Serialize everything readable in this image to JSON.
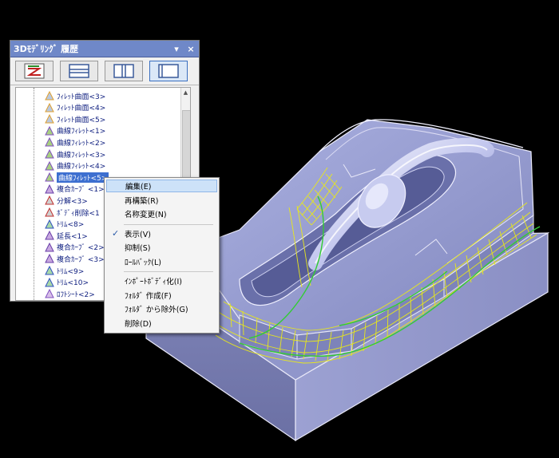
{
  "panel": {
    "title": "3Dﾓﾃﾞﾘﾝｸﾞ 履歴",
    "pin_glyph": "▾",
    "close_glyph": "×"
  },
  "toolbar": {
    "icons": [
      "history-regen-icon",
      "split-horizontal-icon",
      "split-vertical-icon",
      "single-pane-icon"
    ]
  },
  "tree": {
    "items": [
      {
        "label": "ﾌｨﾚｯﾄ曲面<3>",
        "icon": "fillet-surface-icon"
      },
      {
        "label": "ﾌｨﾚｯﾄ曲面<4>",
        "icon": "fillet-surface-icon"
      },
      {
        "label": "ﾌｨﾚｯﾄ曲面<5>",
        "icon": "fillet-surface-icon"
      },
      {
        "label": "曲線ﾌｨﾚｯﾄ<1>",
        "icon": "curve-fillet-icon"
      },
      {
        "label": "曲線ﾌｨﾚｯﾄ<2>",
        "icon": "curve-fillet-icon"
      },
      {
        "label": "曲線ﾌｨﾚｯﾄ<3>",
        "icon": "curve-fillet-icon"
      },
      {
        "label": "曲線ﾌｨﾚｯﾄ<4>",
        "icon": "curve-fillet-icon"
      },
      {
        "label": "曲線ﾌｨﾚｯﾄ<5>",
        "icon": "curve-fillet-icon",
        "selected": true
      },
      {
        "label": "複合ｶｰﾌﾞ <1>",
        "icon": "composite-curve-icon"
      },
      {
        "label": "分解<3>",
        "icon": "explode-icon"
      },
      {
        "label": "ﾎﾞﾃﾞｨ削除<1",
        "icon": "delete-body-icon"
      },
      {
        "label": "ﾄﾘﾑ<8>",
        "icon": "trim-icon"
      },
      {
        "label": "延長<1>",
        "icon": "extend-icon"
      },
      {
        "label": "複合ｶｰﾌﾞ <2>",
        "icon": "composite-curve-icon"
      },
      {
        "label": "複合ｶｰﾌﾞ <3>",
        "icon": "composite-curve-icon"
      },
      {
        "label": "ﾄﾘﾑ<9>",
        "icon": "trim-icon"
      },
      {
        "label": "ﾄﾘﾑ<10>",
        "icon": "trim-icon"
      },
      {
        "label": "ﾛﾌﾄｼｰﾄ<2>",
        "icon": "loft-sheet-icon"
      }
    ]
  },
  "context_menu": {
    "items": [
      {
        "label": "編集(E)",
        "highlighted": true
      },
      {
        "label": "再構築(R)"
      },
      {
        "label": "名称変更(N)"
      },
      {
        "separator": true
      },
      {
        "label": "表示(V)",
        "checked": true
      },
      {
        "label": "抑制(S)"
      },
      {
        "label": "ﾛｰﾙﾊﾞｯｸ(L)"
      },
      {
        "separator": true
      },
      {
        "label": "ｲﾝﾎﾟｰﾄﾎﾞﾃﾞｨ化(I)"
      },
      {
        "label": "ﾌｫﾙﾀﾞ 作成(F)"
      },
      {
        "label": "ﾌｫﾙﾀﾞ から除外(G)"
      },
      {
        "label": "削除(D)"
      }
    ],
    "check_glyph": "✓"
  },
  "colors": {
    "viewport_bg": "#000000",
    "model_face": "#8a8fc4",
    "edge": "#e8e8f8",
    "mesh": "#e8e81a",
    "curve": "#33cc33",
    "title_bar": "#6f88c8",
    "selection": "#3d6fd0"
  }
}
